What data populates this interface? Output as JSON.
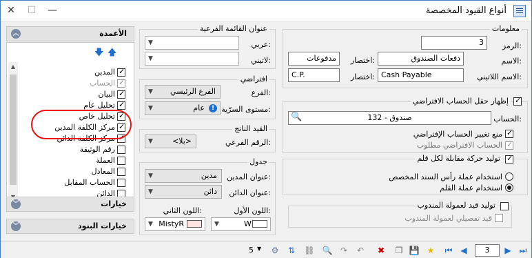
{
  "window": {
    "title": "أنواع القيود المخصصة",
    "controls": {
      "close": "✕",
      "maximize": "☐",
      "minimize": "—"
    }
  },
  "left_panel": {
    "columns_header": "الأعمدة",
    "columns": [
      {
        "label": "المدين",
        "checked": true,
        "dim": false
      },
      {
        "label": "الحساب",
        "checked": true,
        "dim": true
      },
      {
        "label": "البيان",
        "checked": true,
        "dim": false
      },
      {
        "label": "تحليل عام",
        "checked": true,
        "dim": false
      },
      {
        "label": "تحليل خاص",
        "checked": true,
        "dim": false
      },
      {
        "label": "مركز الكلفة المدين",
        "checked": true,
        "dim": false
      },
      {
        "label": "مركز الكلفة الدائن",
        "checked": true,
        "dim": false
      },
      {
        "label": "رقم الوثيقة",
        "checked": false,
        "dim": false
      },
      {
        "label": "العملة",
        "checked": false,
        "dim": false
      },
      {
        "label": "المعادل",
        "checked": false,
        "dim": false
      },
      {
        "label": "الحساب المقابل",
        "checked": false,
        "dim": false
      },
      {
        "label": "الدائن",
        "checked": false,
        "dim": false
      }
    ],
    "options_header": "خيارات",
    "item_options_header": "خيارات البنود"
  },
  "sub_menu": {
    "title": "عنوان القائمة الفرعية",
    "arabic_label": "عربي:",
    "arabic_value": "",
    "latin_label": "لاتيني:",
    "latin_value": ""
  },
  "default_box": {
    "title": "افتراضي",
    "branch_label": "الفرع:",
    "branch_value": "الفرع الرئيسي",
    "security_label": "مستوى السرّية:",
    "security_value": "عام"
  },
  "generated_entry": {
    "title": "القيد الناتج",
    "sub_number_label": "الرقم الفرعي:",
    "sub_number_value": "<بلا>"
  },
  "table_box": {
    "title": "جدول",
    "debit_title_label": "عنوان المدين:",
    "debit_title_value": "مدين",
    "credit_title_label": "عنوان الدائن:",
    "credit_title_value": "دائن",
    "color1_label": "اللون الأول:",
    "color1_value": "White",
    "color1_hex": "#ffffff",
    "color2_label": "اللون الثاني:",
    "color2_value": "MistyR",
    "color2_hex": "#ffe4e1"
  },
  "info": {
    "title": "معلومات",
    "code_label": "الرمز:",
    "code_value": "3",
    "name_label": "الاسم:",
    "name_value": "دفعات الصندوق",
    "abbr_label": "اختصار:",
    "abbr_value": "مدفوعات",
    "latin_name_label": "الاسم اللاتيني:",
    "latin_name_value": "Cash Payable",
    "latin_abbr_label": "اختصار:",
    "latin_abbr_value": "C.P."
  },
  "account_box": {
    "show_default_label": "إظهار حقل الحساب الافتراضي",
    "account_label": "الحساب:",
    "account_value": "132 - صندوق",
    "prevent_change_label": "منع تغيير الحساب الإفتراضي",
    "required_label": "الحساب الافتراضي مطلوب"
  },
  "pen_box": {
    "generate_label": "توليد حركة مقابلة لكل قلم",
    "use_header_currency_label": "استخدام عملة رأس السند المخصص",
    "use_pen_currency_label": "استخدام عملة القلم"
  },
  "rep_box": {
    "generate_commission_label": "توليد قيد لعمولة المندوب",
    "detailed_label": "قيد تفصيلي لعمولة المندوب"
  },
  "bottom": {
    "count": "5",
    "record_number": "3"
  }
}
